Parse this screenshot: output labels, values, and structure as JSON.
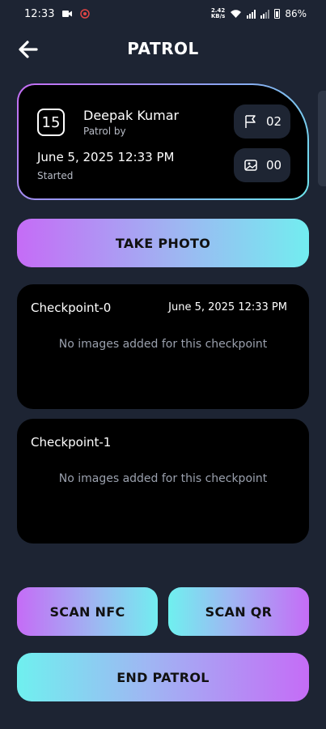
{
  "status_bar": {
    "time": "12:33",
    "net_speed_value": "2.42",
    "net_speed_unit": "KB/s",
    "battery": "86%"
  },
  "header": {
    "title": "PATROL",
    "back_icon": "arrow-left-icon"
  },
  "patrol": {
    "day": "15",
    "user_name": "Deepak Kumar",
    "user_subtitle": "Patrol by",
    "start_time": "June 5, 2025 12:33 PM",
    "status": "Started",
    "checkpoints_count": "02",
    "checkpoints_icon": "flag-icon",
    "images_count": "00",
    "images_icon": "image-icon"
  },
  "buttons": {
    "take_photo": "TAKE PHOTO",
    "scan_nfc": "SCAN NFC",
    "scan_qr": "SCAN QR",
    "end_patrol": "END PATROL"
  },
  "checkpoints": [
    {
      "name": "Checkpoint-0",
      "time": "June 5, 2025 12:33 PM",
      "empty_text": "No images added for this checkpoint"
    },
    {
      "name": "Checkpoint-1",
      "time": "",
      "empty_text": "No images added for this checkpoint"
    }
  ],
  "colors": {
    "background": "#1d2433",
    "card": "#000000",
    "gradient_purple": "#c56cf6",
    "gradient_cyan": "#72edf0"
  }
}
